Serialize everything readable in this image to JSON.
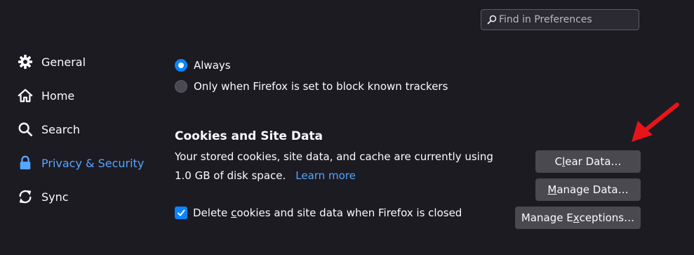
{
  "search": {
    "placeholder": "Find in Preferences"
  },
  "sidebar": {
    "items": [
      {
        "label": "General",
        "icon": "gear-icon"
      },
      {
        "label": "Home",
        "icon": "home-icon"
      },
      {
        "label": "Search",
        "icon": "search-icon"
      },
      {
        "label": "Privacy & Security",
        "icon": "lock-icon",
        "selected": true
      },
      {
        "label": "Sync",
        "icon": "sync-icon"
      }
    ]
  },
  "tracking": {
    "options": [
      {
        "label": "Always",
        "checked": true
      },
      {
        "label": "Only when Firefox is set to block known trackers",
        "checked": false
      }
    ]
  },
  "cookies": {
    "title": "Cookies and Site Data",
    "desc_line1": "Your stored cookies, site data, and cache are currently using",
    "desc_line2": "1.0 GB of disk space.",
    "learn_more": "Learn more",
    "delete_on_close": {
      "pre": "Delete ",
      "accesskey": "c",
      "post": "ookies and site data when Firefox is closed",
      "checked": true
    },
    "buttons": {
      "clear": {
        "pre": "C",
        "accesskey": "l",
        "post": "ear Data…"
      },
      "manage": {
        "pre": "",
        "accesskey": "M",
        "post": "anage Data…"
      },
      "exceptions": {
        "pre": "Manage E",
        "accesskey": "x",
        "post": "ceptions…"
      }
    }
  },
  "colors": {
    "background": "#1c1b22",
    "accent": "#0a84ff",
    "link": "#54a6ff",
    "button": "#4a4950",
    "annotation_arrow": "#e8141a"
  }
}
